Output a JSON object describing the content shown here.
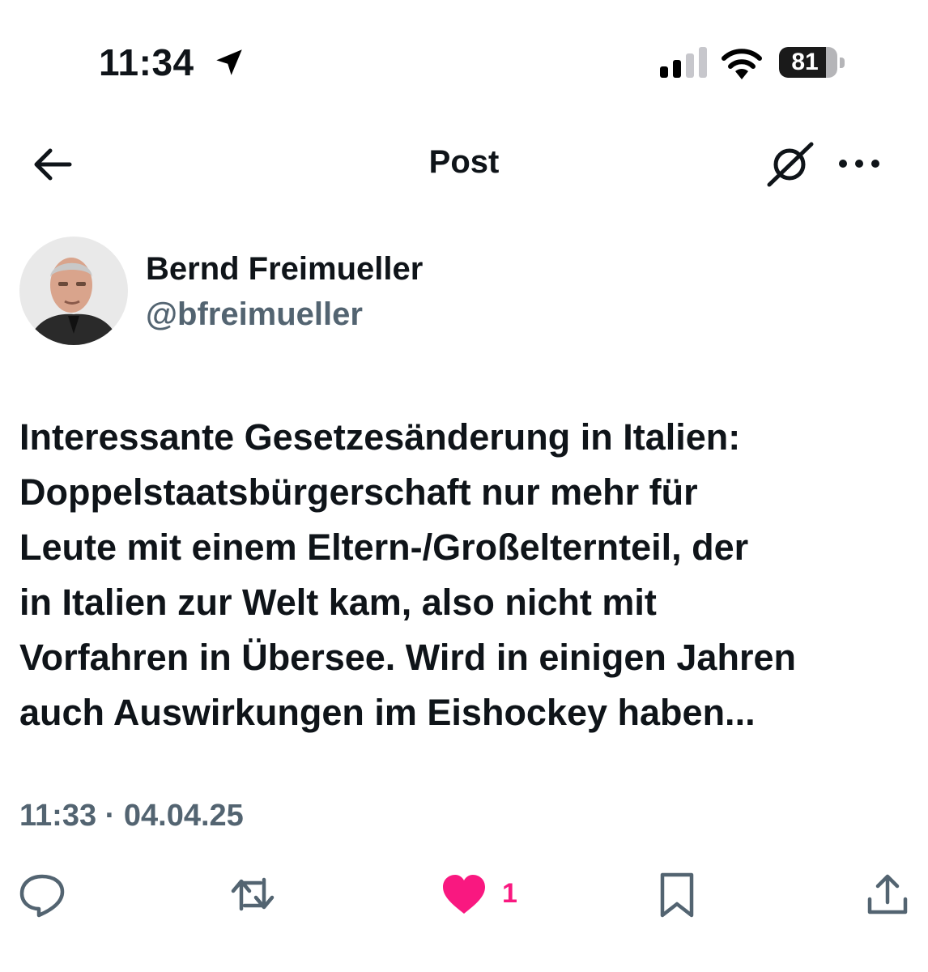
{
  "status_bar": {
    "time": "11:34",
    "battery": "81",
    "battery_level": 0.81,
    "icons": [
      "location-arrow-icon",
      "cellular-signal-icon",
      "wifi-icon",
      "battery-icon"
    ]
  },
  "header": {
    "title": "Post",
    "icons": [
      "back-arrow-icon",
      "grok-icon",
      "more-icon"
    ]
  },
  "author": {
    "name": "Bernd Freimueller",
    "handle": "@bfreimueller"
  },
  "post": {
    "lines": [
      "Interessante Gesetzesänderung in Italien:",
      "Doppelstaatsbürgerschaft nur mehr für",
      "Leute mit einem Eltern-/Großelternteil, der",
      "in Italien zur Welt kam, also nicht mit",
      "Vorfahren in Übersee. Wird in einigen Jahren",
      "auch Auswirkungen im Eishockey haben..."
    ],
    "timestamp": "11:33 · 04.04.25"
  },
  "actions": {
    "like_count": "1",
    "icons": [
      "reply-icon",
      "repost-icon",
      "heart-icon",
      "bookmark-icon",
      "share-icon"
    ]
  },
  "colors": {
    "text": "#0f1419",
    "secondary": "#536471",
    "like": "#f91880"
  }
}
